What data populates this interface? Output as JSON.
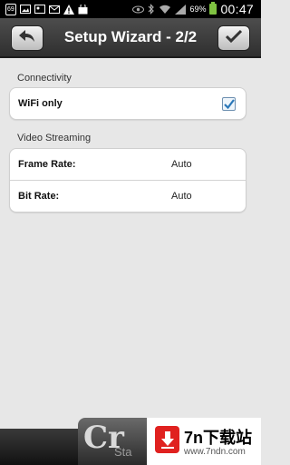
{
  "status_bar": {
    "notif_badge": "69",
    "battery": "69%",
    "time": "00:47"
  },
  "header": {
    "title": "Setup Wizard - 2/2"
  },
  "sections": {
    "connectivity": {
      "label": "Connectivity",
      "wifi_only": {
        "label": "WiFi only",
        "checked": true
      }
    },
    "video_streaming": {
      "label": "Video Streaming",
      "frame_rate": {
        "label": "Frame Rate:",
        "value": "Auto"
      },
      "bit_rate": {
        "label": "Bit Rate:",
        "value": "Auto"
      }
    }
  },
  "ad": {
    "left_big": "Cr",
    "left_small": "Sta",
    "title": "7n下载站",
    "url": "www.7ndn.com"
  },
  "colors": {
    "title_bar": "#3d3d3d",
    "checkbox_check": "#2a77b8",
    "battery": "#7fc241",
    "ad_logo": "#e0211f"
  }
}
